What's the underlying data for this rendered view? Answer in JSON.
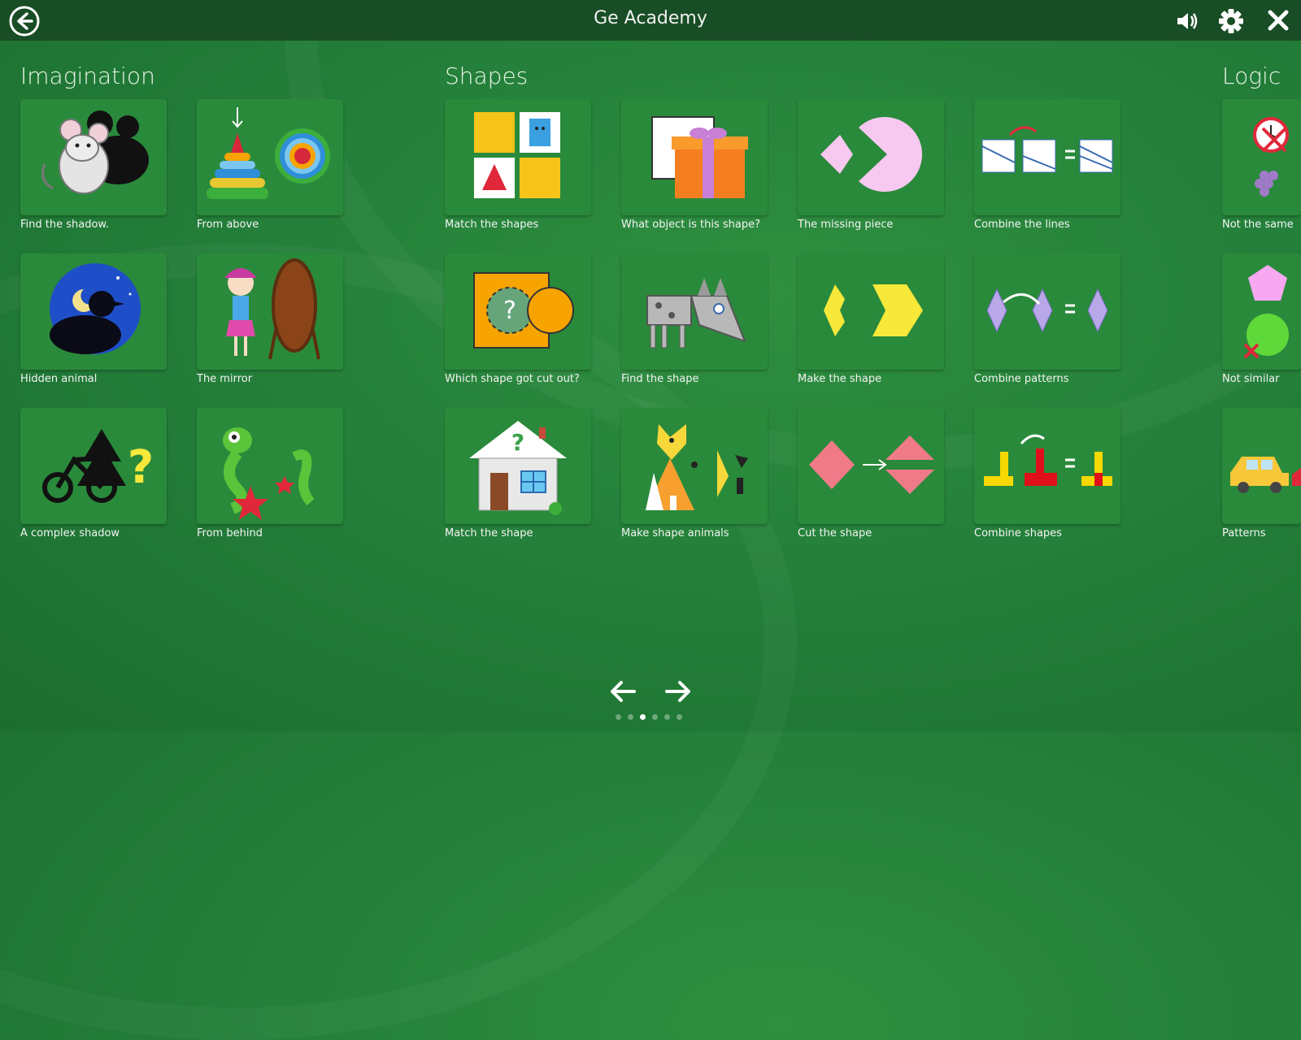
{
  "header": {
    "title": "Ge Academy"
  },
  "sections": {
    "imagination": "Imagination",
    "shapes": "Shapes",
    "logic": "Logic"
  },
  "cards": {
    "find_shadow": "Find the shadow.",
    "from_above": "From above",
    "match_shapes": "Match the shapes",
    "what_object": "What object is this shape?",
    "missing_piece": "The missing piece",
    "combine_lines": "Combine the lines",
    "not_same": "Not the same",
    "hidden_animal": "Hidden animal",
    "mirror": "The mirror",
    "which_cut": "Which shape got cut out?",
    "find_shape": "Find the shape",
    "make_shape": "Make the shape",
    "combine_patterns": "Combine patterns",
    "not_similar": "Not similar",
    "complex_shadow": "A complex shadow",
    "from_behind": "From behind",
    "match_shape": "Match the shape",
    "shape_animals": "Make shape animals",
    "cut_shape": "Cut the shape",
    "combine_shapes": "Combine shapes",
    "patterns": "Patterns"
  },
  "pagination": {
    "pages": 6,
    "active_page": 3
  }
}
